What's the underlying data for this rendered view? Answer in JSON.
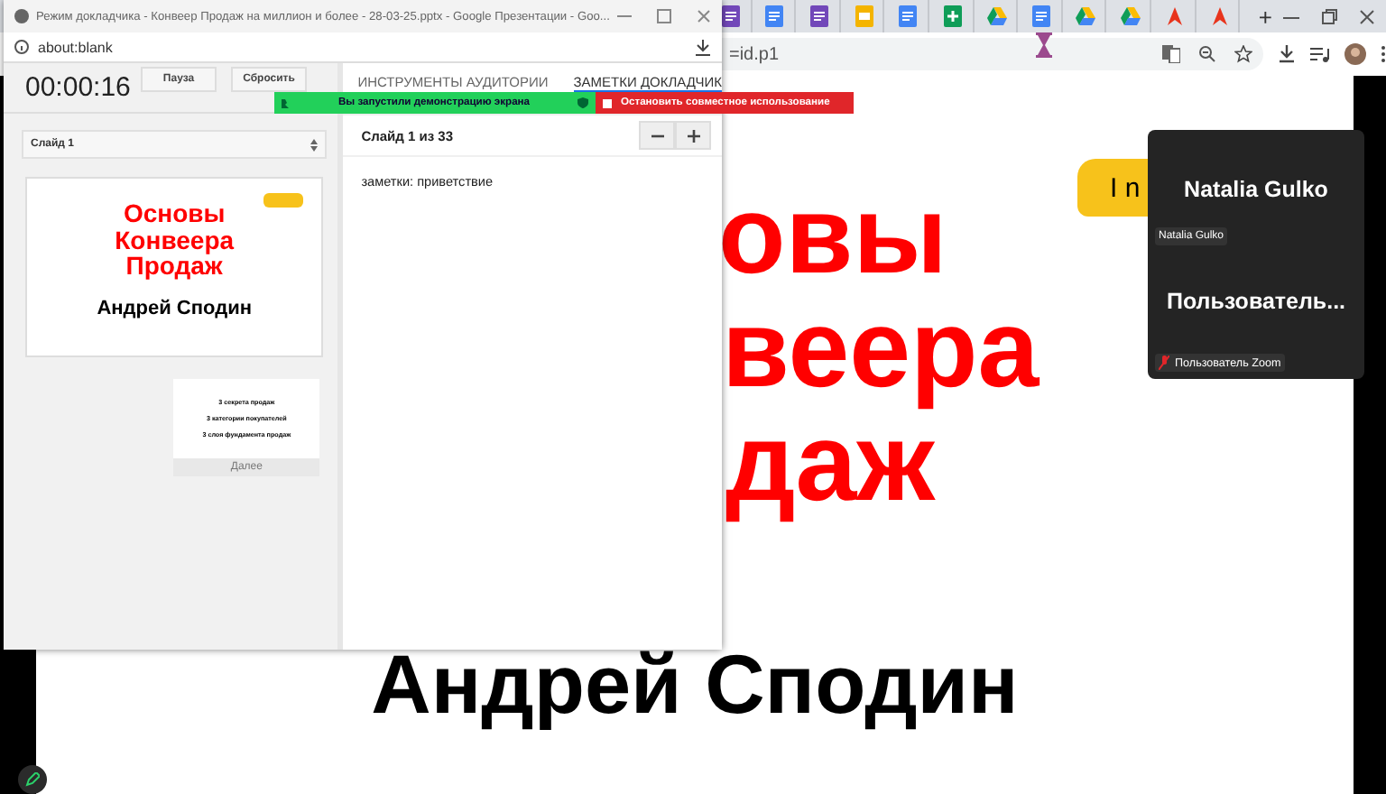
{
  "browser": {
    "tabs": [
      {
        "kind": "forms"
      },
      {
        "kind": "docs"
      },
      {
        "kind": "forms"
      },
      {
        "kind": "slides"
      },
      {
        "kind": "docs"
      },
      {
        "kind": "sheets"
      },
      {
        "kind": "drive"
      },
      {
        "kind": "docs"
      },
      {
        "kind": "drive"
      },
      {
        "kind": "drive"
      },
      {
        "kind": "acrobat"
      },
      {
        "kind": "acrobat"
      }
    ],
    "new_tab": "+",
    "url": "=id.p1"
  },
  "slide": {
    "title_fragments": [
      "овы",
      "веера",
      "даж"
    ],
    "sticker_text": "I n",
    "author": "Андрей Сподин"
  },
  "presenter": {
    "title": "Режим докладчика - Конвеер Продаж на миллион и более - 28-03-25.pptx - Google Презентации - Goo...",
    "url": "about:blank",
    "timer": "00:00:16",
    "buttons": [
      "Пауза",
      "Сбросить"
    ],
    "tabs": [
      {
        "label": "ИНСТРУМЕНТЫ АУДИТОРИИ",
        "selected": false
      },
      {
        "label": "ЗАМЕТКИ ДОКЛАДЧИК",
        "selected": true
      }
    ],
    "slide_select": "Слайд 1",
    "current_slide": {
      "title": [
        "Основы",
        "Конвеера",
        "Продаж"
      ],
      "author": "Андрей Сподин"
    },
    "next_slide": {
      "lines": [
        "3 секрета продаж",
        "3 категории покупателей",
        "3 слоя фундамента продаж"
      ],
      "label": "Далее"
    },
    "notes_header": "Слайд 1 из 33",
    "notes": "заметки: приветствие"
  },
  "share_bar": {
    "status": "Вы запустили демонстрацию экрана",
    "stop": "Остановить совместное использование"
  },
  "zoom": {
    "name": "Natalia Gulko",
    "name_label": "Natalia Gulko",
    "user": "Пользователь...",
    "user_label": "Пользователь Zoom",
    "muted": true
  }
}
